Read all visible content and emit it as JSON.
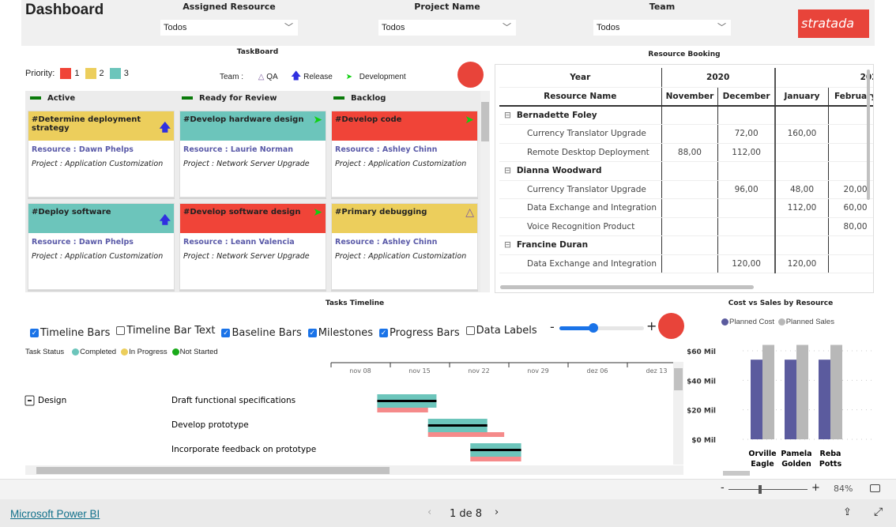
{
  "header": {
    "title": "Dashboard",
    "filters": [
      {
        "label": "Assigned Resource",
        "value": "Todos"
      },
      {
        "label": "Project Name",
        "value": "Todos"
      },
      {
        "label": "Team",
        "value": "Todos"
      }
    ],
    "logo_text": "stratada"
  },
  "taskboard": {
    "title": "TaskBoard",
    "priority_label": "Priority:",
    "priorities": [
      {
        "label": "1",
        "color": "#f04438"
      },
      {
        "label": "2",
        "color": "#ecce5c"
      },
      {
        "label": "3",
        "color": "#6cc5bb"
      }
    ],
    "team_label": "Team :",
    "teams": [
      {
        "label": "QA",
        "icon": "triangle-icon"
      },
      {
        "label": "Release",
        "icon": "arrow-up-icon"
      },
      {
        "label": "Development",
        "icon": "chevron-icon"
      }
    ],
    "columns": [
      {
        "title": "Active",
        "cards": [
          {
            "title": "#Determine deployment strategy",
            "color": "#ecce5c",
            "team": "release",
            "resource": "Resource : Dawn Phelps",
            "project": "Project : Application Customization"
          },
          {
            "title": "#Deploy software",
            "color": "#6cc5bb",
            "team": "release",
            "resource": "Resource : Dawn Phelps",
            "project": "Project : Application Customization"
          }
        ]
      },
      {
        "title": "Ready for Review",
        "cards": [
          {
            "title": "#Develop hardware design",
            "color": "#6cc5bb",
            "team": "development",
            "resource": "Resource : Laurie Norman",
            "project": "Project : Network Server Upgrade"
          },
          {
            "title": "#Develop software design",
            "color": "#f04438",
            "team": "development",
            "resource": "Resource : Leann Valencia",
            "project": "Project : Network Server Upgrade"
          }
        ]
      },
      {
        "title": "Backlog",
        "cards": [
          {
            "title": "#Develop code",
            "color": "#f04438",
            "team": "development",
            "resource": "Resource : Ashley Chinn",
            "project": "Project : Application Customization"
          },
          {
            "title": "#Primary debugging",
            "color": "#ecce5c",
            "team": "qa",
            "resource": "Resource : Ashley Chinn",
            "project": "Project : Application Customization"
          }
        ]
      }
    ]
  },
  "booking": {
    "title": "Resource Booking",
    "year_label": "Year",
    "name_label": "Resource Name",
    "years": [
      "2020",
      "202"
    ],
    "months": [
      "November",
      "December",
      "January",
      "February"
    ],
    "groups": [
      {
        "name": "Bernadette Foley",
        "rows": [
          {
            "name": "Currency Translator Upgrade",
            "values": [
              "",
              "72,00",
              "160,00",
              ""
            ]
          },
          {
            "name": "Remote Desktop Deployment",
            "values": [
              "88,00",
              "112,00",
              "",
              ""
            ]
          }
        ]
      },
      {
        "name": "Dianna Woodward",
        "rows": [
          {
            "name": "Currency Translator Upgrade",
            "values": [
              "",
              "96,00",
              "48,00",
              "20,00"
            ]
          },
          {
            "name": "Data Exchange and Integration",
            "values": [
              "",
              "",
              "112,00",
              "60,00"
            ]
          },
          {
            "name": "Voice Recognition Product",
            "values": [
              "",
              "",
              "",
              "80,00"
            ]
          }
        ]
      },
      {
        "name": "Francine Duran",
        "rows": [
          {
            "name": "Data Exchange and Integration",
            "values": [
              "",
              "120,00",
              "120,00",
              ""
            ]
          }
        ]
      }
    ]
  },
  "timeline": {
    "title": "Tasks Timeline",
    "options": [
      {
        "label": "Timeline Bars",
        "checked": true
      },
      {
        "label": "Timeline Bar Text",
        "checked": false
      },
      {
        "label": "Baseline Bars",
        "checked": true
      },
      {
        "label": "Milestones",
        "checked": true
      },
      {
        "label": "Progress Bars",
        "checked": true
      },
      {
        "label": "Data Labels",
        "checked": false
      }
    ],
    "zoom_minus": "-",
    "zoom_plus": "+",
    "zoom_level": 0.4,
    "status_label": "Task Status",
    "statuses": [
      {
        "label": "Completed",
        "color": "#6cc5bb"
      },
      {
        "label": "In Progress",
        "color": "#ecce5c"
      },
      {
        "label": "Not Started",
        "color": "#1aaa1a"
      }
    ],
    "axis_ticks": [
      "nov 08",
      "nov 15",
      "nov 22",
      "nov 29",
      "dez 06",
      "dez 13"
    ],
    "group": "Design",
    "tasks": [
      {
        "name": "Draft functional specifications",
        "start": "2020-11-10",
        "end": "2020-11-17",
        "baseline_start": "2020-11-10",
        "baseline_end": "2020-11-16"
      },
      {
        "name": "Develop prototype",
        "start": "2020-11-16",
        "end": "2020-11-23",
        "baseline_start": "2020-11-16",
        "baseline_end": "2020-11-25"
      },
      {
        "name": "Incorporate feedback on prototype",
        "start": "2020-11-21",
        "end": "2020-11-27",
        "baseline_start": "2020-11-21",
        "baseline_end": "2020-11-27"
      }
    ]
  },
  "chart_data": {
    "type": "bar",
    "title": "Cost vs Sales by Resource",
    "categories": [
      "Orville Eagle",
      "Pamela Golden",
      "Reba Potts"
    ],
    "series": [
      {
        "name": "Planned Cost",
        "color": "#5b5b9e",
        "values": [
          54,
          54,
          54
        ]
      },
      {
        "name": "Planned Sales",
        "color": "#b8b8b8",
        "values": [
          64,
          64,
          64
        ]
      }
    ],
    "yticks": [
      "$0 Mil",
      "$20 Mil",
      "$40 Mil",
      "$60 Mil"
    ],
    "ylim": [
      0,
      64
    ],
    "legend": "top",
    "grid": true
  },
  "footer": {
    "zoom_percent": "84%",
    "brand": "Microsoft Power BI",
    "page": "1 de 8"
  }
}
